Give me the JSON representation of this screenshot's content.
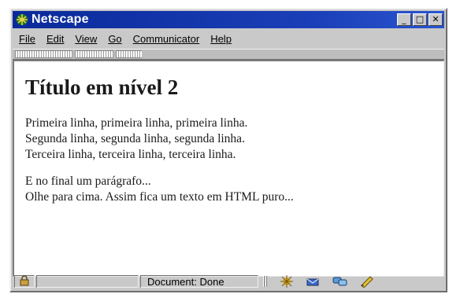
{
  "window": {
    "title": "Netscape",
    "controls": {
      "minimize": "_",
      "maximize": "□",
      "close": "✕"
    }
  },
  "menu": [
    "File",
    "Edit",
    "View",
    "Go",
    "Communicator",
    "Help"
  ],
  "page": {
    "heading": "Título em nível 2",
    "paragraph1": [
      "Primeira linha, primeira linha, primeira linha.",
      "Segunda linha, segunda linha, segunda linha.",
      "Terceira linha, terceira linha, terceira linha."
    ],
    "paragraph2": [
      "E no final um parágrafo...",
      "Olhe para cima. Assim fica um texto em HTML puro..."
    ]
  },
  "status": {
    "text": "Document: Done",
    "icons": [
      "lock-icon",
      "navigator-icon",
      "mail-icon",
      "discussion-icon",
      "composer-icon"
    ]
  },
  "colors": {
    "titlebar": "#0a2a9a",
    "chrome": "#c9c9c9",
    "page_bg": "#ffffff"
  }
}
